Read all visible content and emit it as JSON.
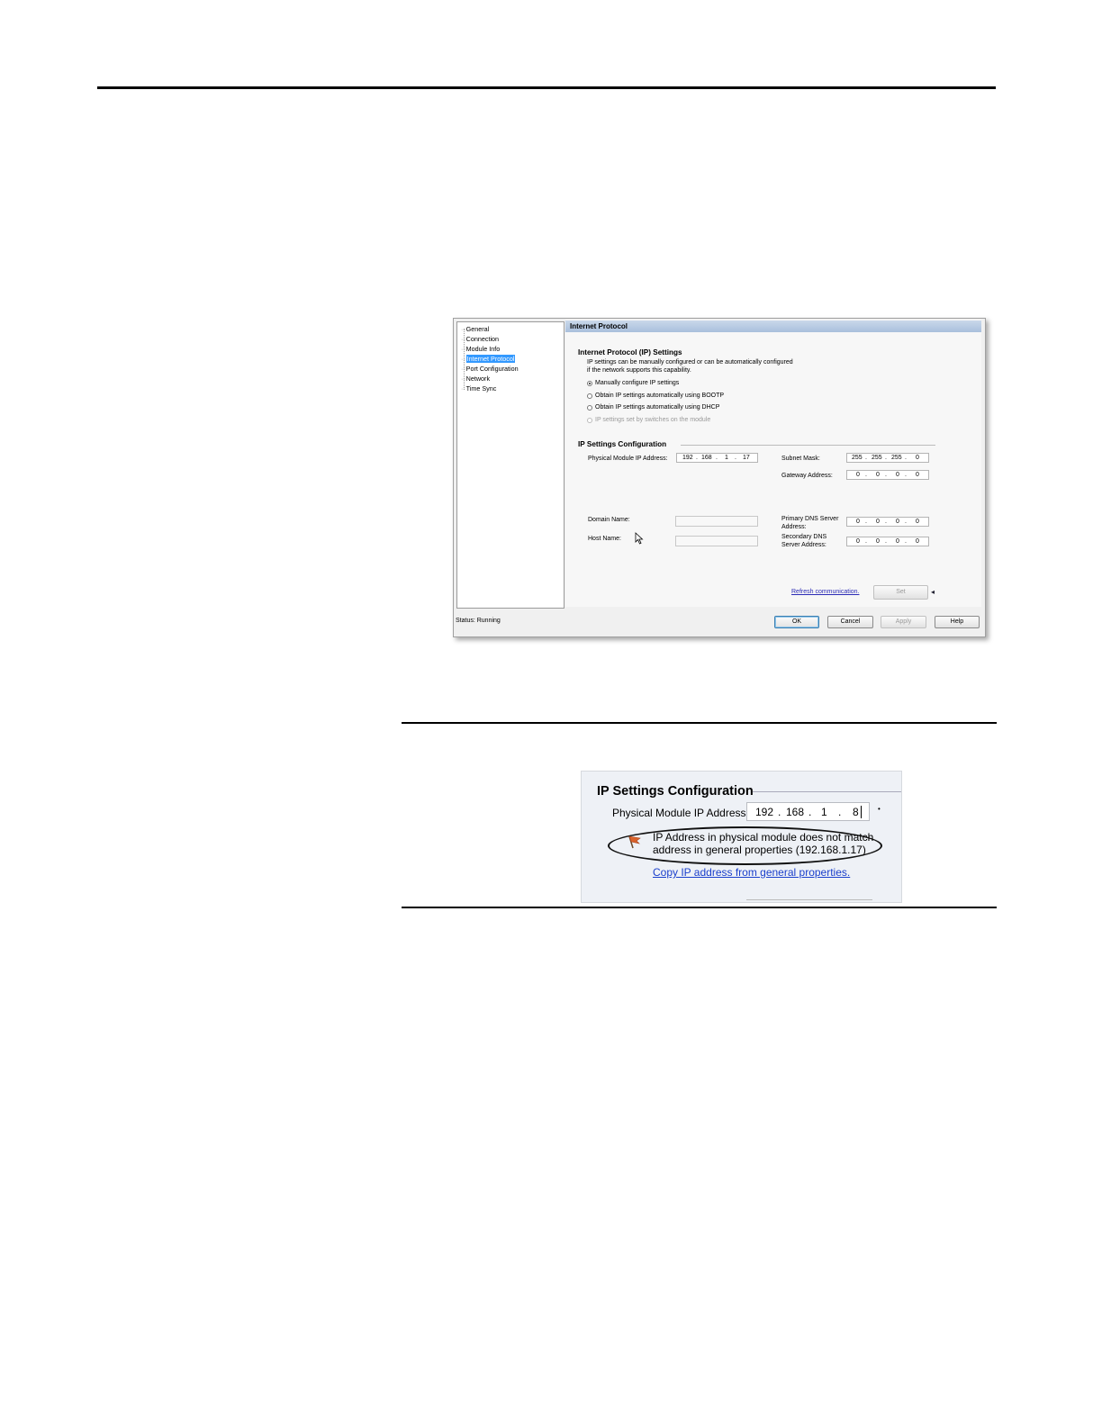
{
  "dialog": {
    "tree_items": [
      "General",
      "Connection",
      "Module Info",
      "Internet Protocol",
      "Port Configuration",
      "Network",
      "Time Sync"
    ],
    "panel_title": "Internet Protocol",
    "ip_settings": {
      "heading": "Internet Protocol (IP) Settings",
      "desc_line1": "IP settings can be manually configured or can be automatically configured",
      "desc_line2": "if the network supports this capability.",
      "options": [
        "Manually configure IP settings",
        "Obtain IP settings automatically using BOOTP",
        "Obtain IP settings automatically using DHCP",
        "IP settings set by switches on the module"
      ]
    },
    "config": {
      "heading": "IP Settings Configuration",
      "ip_label": "Physical Module IP Address:",
      "ip_value": [
        "192",
        "168",
        "1",
        "17"
      ],
      "subnet_label": "Subnet Mask:",
      "subnet_value": [
        "255",
        "255",
        "255",
        "0"
      ],
      "gateway_label": "Gateway Address:",
      "gateway_value": [
        "0",
        "0",
        "0",
        "0"
      ],
      "domain_label": "Domain Name:",
      "host_label": "Host Name:",
      "primary_dns_label1": "Primary DNS Server",
      "primary_dns_label2": "Address:",
      "primary_dns_value": [
        "0",
        "0",
        "0",
        "0"
      ],
      "secondary_dns_label1": "Secondary DNS",
      "secondary_dns_label2": "Server Address:",
      "secondary_dns_value": [
        "0",
        "0",
        "0",
        "0"
      ]
    },
    "refresh_link": "Refresh communication.",
    "set_button": "Set",
    "status": "Status:  Running",
    "buttons": {
      "ok": "OK",
      "cancel": "Cancel",
      "apply": "Apply",
      "help": "Help"
    }
  },
  "zoom": {
    "heading": "IP Settings Configuration",
    "ip_label": "Physical Module IP Address:",
    "ip_value": [
      "192",
      "168",
      "1",
      "8"
    ],
    "warning_line1": "IP Address in physical module does not match",
    "warning_line2": "address in general properties (192.168.1.17)",
    "copy_link": "Copy IP address from general properties."
  },
  "colors": {
    "selection": "#3399ff",
    "header_gradient": "#b5c8e2",
    "link": "#2b2bb5",
    "warning_flag": "#d9622b"
  }
}
